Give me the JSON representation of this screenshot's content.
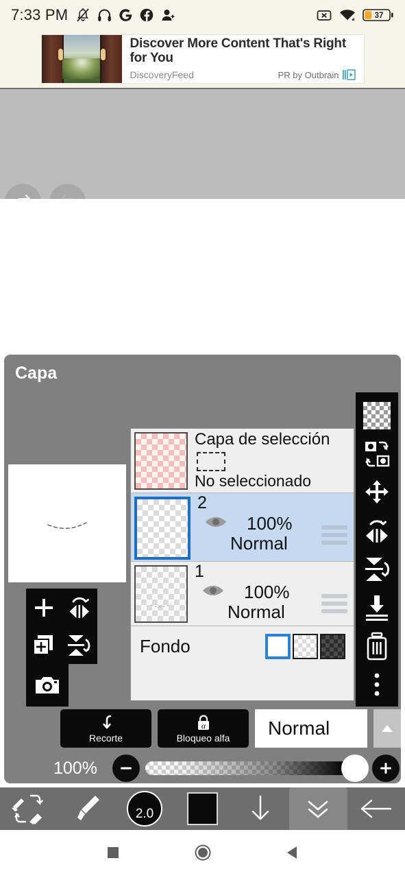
{
  "status_bar": {
    "time": "7:33 PM",
    "left_icons": [
      "bell-off-icon",
      "headphones-icon",
      "google-icon",
      "facebook-icon",
      "add-person-icon"
    ],
    "right_icons": [
      "no-sim-icon",
      "wifi-icon"
    ],
    "battery_percent": "37",
    "battery_color": "#f5a623"
  },
  "ad": {
    "title": "Discover More Content That's Right for You",
    "source": "DiscoveryFeed",
    "attribution": "PR by Outbrain",
    "logo": "outbrain-logo"
  },
  "top_toolbar": {
    "undo_label": "undo-icon",
    "redo_label": "redo-icon",
    "undo_enabled": true,
    "redo_enabled": false
  },
  "panel": {
    "title": "Capa"
  },
  "layers": [
    {
      "type": "selection",
      "name": "Capa de selección",
      "status": "No seleccionado",
      "thumb": "pink-checker",
      "selected": false
    },
    {
      "type": "layer",
      "name": "2",
      "opacity": "100%",
      "blend": "Normal",
      "thumb": "grey-checker",
      "visible": true,
      "selected": true
    },
    {
      "type": "layer",
      "name": "1",
      "opacity": "100%",
      "blend": "Normal",
      "thumb": "grey-checker",
      "visible": true,
      "selected": false
    }
  ],
  "background_row": {
    "label": "Fondo",
    "swatches": [
      "white",
      "transparent",
      "dark-checker"
    ],
    "selected_index": 0,
    "selected_color": "#2a82da"
  },
  "right_toolbar": {
    "items": [
      {
        "icon": "checker-transparency-icon"
      },
      {
        "icon": "swap-layers-icon"
      },
      {
        "icon": "move-icon"
      },
      {
        "icon": "flip-horizontal-icon"
      },
      {
        "icon": "flip-vertical-icon"
      },
      {
        "icon": "merge-down-icon"
      },
      {
        "icon": "delete-trash-icon"
      },
      {
        "icon": "more-vertical-icon"
      }
    ]
  },
  "left_toolbar": {
    "items": [
      {
        "icon": "add-layer-plus-icon"
      },
      {
        "icon": "rotate-flip-horizontal-icon"
      },
      {
        "icon": "duplicate-layer-icon"
      },
      {
        "icon": "rotate-flip-vertical-icon"
      },
      {
        "icon": "camera-import-icon"
      }
    ]
  },
  "controls": {
    "clip_label": "Recorte",
    "clip_icon": "clipping-arrow-icon",
    "alpha_lock_label": "Bloqueo alfa",
    "alpha_lock_icon": "alpha-lock-icon",
    "blend_mode": "Normal",
    "blend_arrow": "chevron-up-icon"
  },
  "opacity_slider": {
    "value_label": "100%",
    "minus_label": "−",
    "plus_label": "+",
    "percent": 100
  },
  "bottom_toolbar": {
    "items": [
      {
        "icon": "undo-redo-eraser-icon",
        "active": false
      },
      {
        "icon": "brush-icon",
        "active": false
      },
      {
        "icon": "brush-size-icon",
        "label": "2.0",
        "active": false
      },
      {
        "icon": "color-swatch-icon",
        "color": "#0a0a0a",
        "active": false
      },
      {
        "icon": "arrow-down-icon",
        "active": false
      },
      {
        "icon": "double-chevron-down-icon",
        "active": true
      },
      {
        "icon": "arrow-left-back-icon",
        "active": false
      }
    ]
  },
  "nav_bar": {
    "items": [
      "recents-square-icon",
      "home-circle-icon",
      "back-triangle-icon"
    ]
  }
}
